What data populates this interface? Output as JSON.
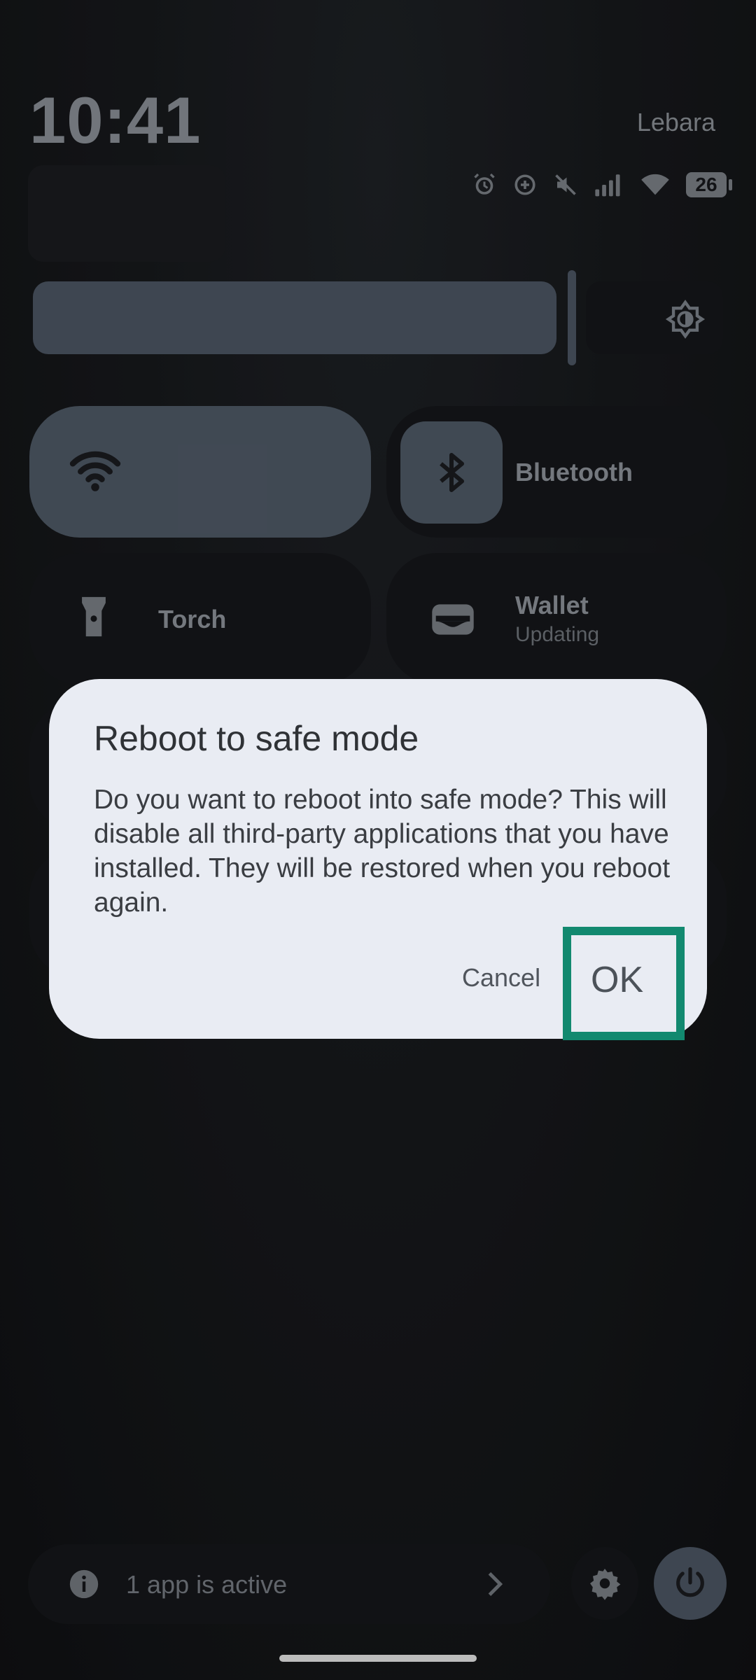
{
  "status": {
    "time": "10:41",
    "carrier": "Lebara",
    "battery": "26"
  },
  "tiles": {
    "bluetooth": "Bluetooth",
    "torch": "Torch",
    "wallet": {
      "label": "Wallet",
      "sub": "Updating"
    }
  },
  "dialog": {
    "title": "Reboot to safe mode",
    "body": "Do you want to reboot into safe mode? This will disable all third-party applications that you have installed. They will be restored when you reboot again.",
    "cancel": "Cancel",
    "ok": "OK"
  },
  "footer": {
    "active_apps": "1 app is active"
  },
  "colors": {
    "highlight": "#12896f",
    "dialog_bg": "#e9ecf3",
    "tile_active": "#4f5966"
  }
}
